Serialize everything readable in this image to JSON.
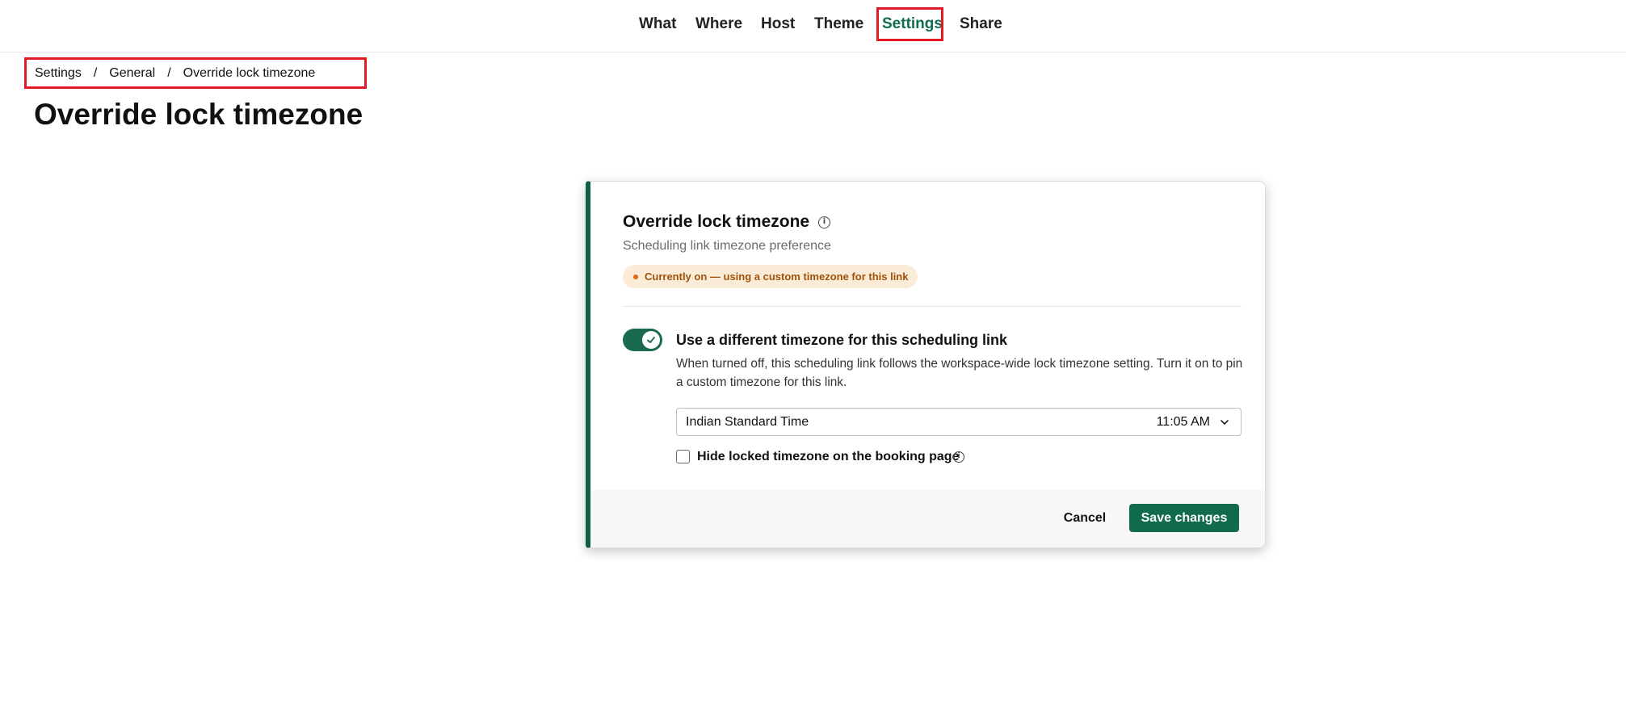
{
  "nav": {
    "items": [
      {
        "label": "What"
      },
      {
        "label": "Where"
      },
      {
        "label": "Host"
      },
      {
        "label": "Theme"
      },
      {
        "label": "Settings",
        "active": true
      },
      {
        "label": "Share"
      }
    ]
  },
  "breadcrumb": {
    "items": [
      "Settings",
      "General",
      "Override lock timezone"
    ],
    "separator": "/"
  },
  "page": {
    "title": "Override lock timezone"
  },
  "card": {
    "title": "Override lock timezone",
    "info_icon": "i",
    "subtitle": "Scheduling link timezone preference",
    "status_badge": "Currently on — using a custom timezone for this link",
    "toggle": {
      "on": true
    },
    "option_label": "Use a different timezone for this scheduling link",
    "option_description": "When turned off, this scheduling link follows the workspace-wide lock timezone setting. Turn it on to pin a custom timezone for this link.",
    "timezone_select": {
      "name": "Indian Standard Time",
      "time": "11:05 AM"
    },
    "hide_checkbox": {
      "checked": false,
      "label": "Hide locked timezone on the booking page"
    },
    "footer": {
      "cancel_label": "Cancel",
      "save_label": "Save changes"
    }
  },
  "colors": {
    "accent": "#136b4f",
    "active_nav": "#0f6e50",
    "highlight_outline": "#e01b24",
    "badge_bg": "#fbecd8",
    "badge_text": "#a0520a"
  }
}
